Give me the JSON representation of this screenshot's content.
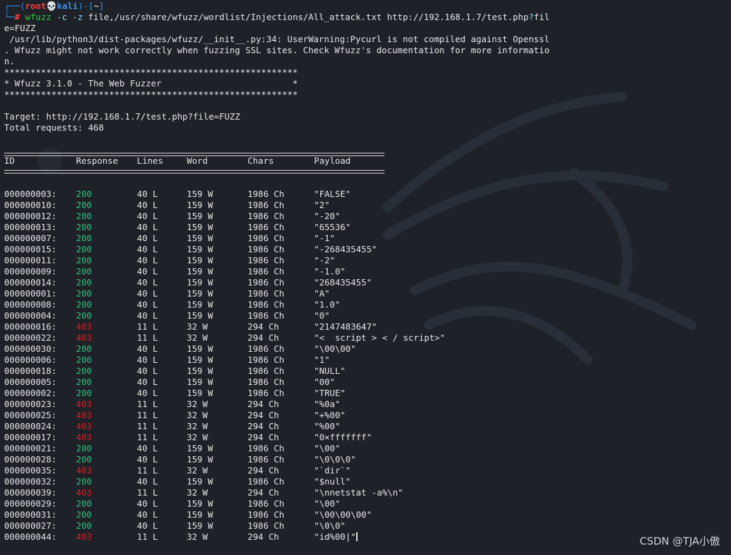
{
  "prompt": {
    "corner_top": "┌──(",
    "user": "root",
    "skull": "💀",
    "host": "kali",
    "mid": ")-[",
    "path": "~",
    "end": "]",
    "corner_bottom": "└─",
    "hash": "#"
  },
  "command": {
    "name": "wfuzz",
    "opt_c": "-c",
    "opt_z": "-z",
    "arg_line1": "file,/usr/share/wfuzz/wordlist/Injections/All_attack.txt http://192.168.1.7/test.php",
    "qmark": "?",
    "arg_tail": "fil",
    "arg_line2": "e=FUZZ"
  },
  "warning": {
    "line1": " /usr/lib/python3/dist-packages/wfuzz/__init__.py:34: UserWarning:Pycurl is not compiled against Openssl",
    "line2": ". Wfuzz might not work correctly when fuzzing SSL sites. Check Wfuzz's documentation for more informatio",
    "line3": "n."
  },
  "banner": {
    "stars": "********************************************************",
    "title": "* Wfuzz 3.1.0 - The Web Fuzzer                         *"
  },
  "target": "Target: http://192.168.1.7/test.php?file=FUZZ",
  "total": "Total requests: 468",
  "headers": {
    "id": "ID",
    "response": "Response",
    "lines": "Lines",
    "word": "Word",
    "chars": "Chars",
    "payload": "Payload"
  },
  "rows": [
    {
      "id": "000000003:",
      "response": "200",
      "lines": "40 L",
      "word": "159 W",
      "chars": "1986 Ch",
      "payload": "\"FALSE\""
    },
    {
      "id": "000000010:",
      "response": "200",
      "lines": "40 L",
      "word": "159 W",
      "chars": "1986 Ch",
      "payload": "\"2\""
    },
    {
      "id": "000000012:",
      "response": "200",
      "lines": "40 L",
      "word": "159 W",
      "chars": "1986 Ch",
      "payload": "\"-20\""
    },
    {
      "id": "000000013:",
      "response": "200",
      "lines": "40 L",
      "word": "159 W",
      "chars": "1986 Ch",
      "payload": "\"65536\""
    },
    {
      "id": "000000007:",
      "response": "200",
      "lines": "40 L",
      "word": "159 W",
      "chars": "1986 Ch",
      "payload": "\"-1\""
    },
    {
      "id": "000000015:",
      "response": "200",
      "lines": "40 L",
      "word": "159 W",
      "chars": "1986 Ch",
      "payload": "\"-268435455\""
    },
    {
      "id": "000000011:",
      "response": "200",
      "lines": "40 L",
      "word": "159 W",
      "chars": "1986 Ch",
      "payload": "\"-2\""
    },
    {
      "id": "000000009:",
      "response": "200",
      "lines": "40 L",
      "word": "159 W",
      "chars": "1986 Ch",
      "payload": "\"-1.0\""
    },
    {
      "id": "000000014:",
      "response": "200",
      "lines": "40 L",
      "word": "159 W",
      "chars": "1986 Ch",
      "payload": "\"268435455\""
    },
    {
      "id": "000000001:",
      "response": "200",
      "lines": "40 L",
      "word": "159 W",
      "chars": "1986 Ch",
      "payload": "\"A\""
    },
    {
      "id": "000000008:",
      "response": "200",
      "lines": "40 L",
      "word": "159 W",
      "chars": "1986 Ch",
      "payload": "\"1.0\""
    },
    {
      "id": "000000004:",
      "response": "200",
      "lines": "40 L",
      "word": "159 W",
      "chars": "1986 Ch",
      "payload": "\"0\""
    },
    {
      "id": "000000016:",
      "response": "403",
      "lines": "11 L",
      "word": "32 W",
      "chars": "294 Ch",
      "payload": "\"2147483647\""
    },
    {
      "id": "000000022:",
      "response": "403",
      "lines": "11 L",
      "word": "32 W",
      "chars": "294 Ch",
      "payload": "\"<  script > < / script>\""
    },
    {
      "id": "000000030:",
      "response": "200",
      "lines": "40 L",
      "word": "159 W",
      "chars": "1986 Ch",
      "payload": "\"\\00\\00\""
    },
    {
      "id": "000000006:",
      "response": "200",
      "lines": "40 L",
      "word": "159 W",
      "chars": "1986 Ch",
      "payload": "\"1\""
    },
    {
      "id": "000000018:",
      "response": "200",
      "lines": "40 L",
      "word": "159 W",
      "chars": "1986 Ch",
      "payload": "\"NULL\""
    },
    {
      "id": "000000005:",
      "response": "200",
      "lines": "40 L",
      "word": "159 W",
      "chars": "1986 Ch",
      "payload": "\"00\""
    },
    {
      "id": "000000002:",
      "response": "200",
      "lines": "40 L",
      "word": "159 W",
      "chars": "1986 Ch",
      "payload": "\"TRUE\""
    },
    {
      "id": "000000023:",
      "response": "403",
      "lines": "11 L",
      "word": "32 W",
      "chars": "294 Ch",
      "payload": "\"%0a\""
    },
    {
      "id": "000000025:",
      "response": "403",
      "lines": "11 L",
      "word": "32 W",
      "chars": "294 Ch",
      "payload": "\"+%00\""
    },
    {
      "id": "000000024:",
      "response": "403",
      "lines": "11 L",
      "word": "32 W",
      "chars": "294 Ch",
      "payload": "\"%00\""
    },
    {
      "id": "000000017:",
      "response": "403",
      "lines": "11 L",
      "word": "32 W",
      "chars": "294 Ch",
      "payload": "\"0×fffffff\""
    },
    {
      "id": "000000021:",
      "response": "200",
      "lines": "40 L",
      "word": "159 W",
      "chars": "1986 Ch",
      "payload": "\"\\00\""
    },
    {
      "id": "000000028:",
      "response": "200",
      "lines": "40 L",
      "word": "159 W",
      "chars": "1986 Ch",
      "payload": "\"\\0\\0\\0\""
    },
    {
      "id": "000000035:",
      "response": "403",
      "lines": "11 L",
      "word": "32 W",
      "chars": "294 Ch",
      "payload": "\"`dir`\""
    },
    {
      "id": "000000032:",
      "response": "200",
      "lines": "40 L",
      "word": "159 W",
      "chars": "1986 Ch",
      "payload": "\"$null\""
    },
    {
      "id": "000000039:",
      "response": "403",
      "lines": "11 L",
      "word": "32 W",
      "chars": "294 Ch",
      "payload": "\"\\nnetstat -a%\\n\""
    },
    {
      "id": "000000029:",
      "response": "200",
      "lines": "40 L",
      "word": "159 W",
      "chars": "1986 Ch",
      "payload": "\"\\00\""
    },
    {
      "id": "000000031:",
      "response": "200",
      "lines": "40 L",
      "word": "159 W",
      "chars": "1986 Ch",
      "payload": "\"\\00\\00\\00\""
    },
    {
      "id": "000000027:",
      "response": "200",
      "lines": "40 L",
      "word": "159 W",
      "chars": "1986 Ch",
      "payload": "\"\\0\\0\""
    },
    {
      "id": "000000044:",
      "response": "403",
      "lines": "11 L",
      "word": "32 W",
      "chars": "294 Ch",
      "payload": "\"id%00|\""
    }
  ],
  "watermark": "CSDN @TJA小傲",
  "colors": {
    "background": "#1e2127",
    "ok": "#2ec27e",
    "forbidden": "#e01b24",
    "prompt": "#3b8eea",
    "root": "#ff3b3b"
  }
}
